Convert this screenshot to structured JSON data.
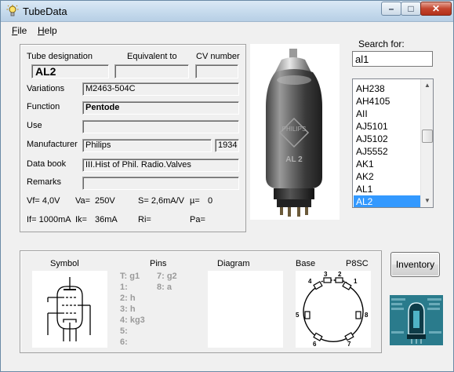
{
  "window": {
    "title": "TubeData",
    "min_icon": "minimize-icon",
    "max_icon": "maximize-icon",
    "close_icon": "close-icon"
  },
  "menu": {
    "file_prefix": "F",
    "file_rest": "ile",
    "help_prefix": "H",
    "help_rest": "elp"
  },
  "details": {
    "designation_label": "Tube designation",
    "designation_value": "AL2",
    "equivalent_label": "Equivalent to",
    "equivalent_value": "",
    "cv_label": "CV number",
    "cv_value": "",
    "variations_label": "Variations",
    "variations_value": "M2463-504C",
    "function_label": "Function",
    "function_value": "Pentode",
    "use_label": "Use",
    "use_value": "",
    "manufacturer_label": "Manufacturer",
    "manufacturer_value": "Philips",
    "year_value": "1934",
    "databook_label": "Data book",
    "databook_value": "III.Hist of Phil. Radio.Valves",
    "remarks_label": "Remarks",
    "remarks_value": "",
    "vf": "Vf= 4,0V",
    "va": "Va=",
    "va_value": "250V",
    "s": "S= 2,6mA/V",
    "mu": "µ=",
    "mu_value": "0",
    "if": "If= 1000mA",
    "ik": "Ik=",
    "ik_value": "36mA",
    "ri": "Ri=",
    "pa": "Pa="
  },
  "search": {
    "label": "Search for:",
    "value": "al1",
    "items": [
      "AH238",
      "AH4105",
      "AII",
      "AJ5101",
      "AJ5102",
      "AJ5552",
      "AK1",
      "AK2",
      "AL1",
      "AL2"
    ],
    "selected": "AL2"
  },
  "photo": {
    "tube_marking": "AL 2"
  },
  "bottom": {
    "symbol_label": "Symbol",
    "pins_label": "Pins",
    "diagram_label": "Diagram",
    "base_label": "Base",
    "base_type": "P8SC",
    "pins_left": [
      "T: g1",
      "1:",
      "2: h",
      "3: h",
      "4: kg3",
      "5:",
      "6:"
    ],
    "pins_right": [
      "7: g2",
      "8: a"
    ],
    "base_pin_numbers": [
      "1",
      "2",
      "3",
      "4",
      "5",
      "6",
      "7",
      "8"
    ]
  },
  "inventory_label": "Inventory"
}
